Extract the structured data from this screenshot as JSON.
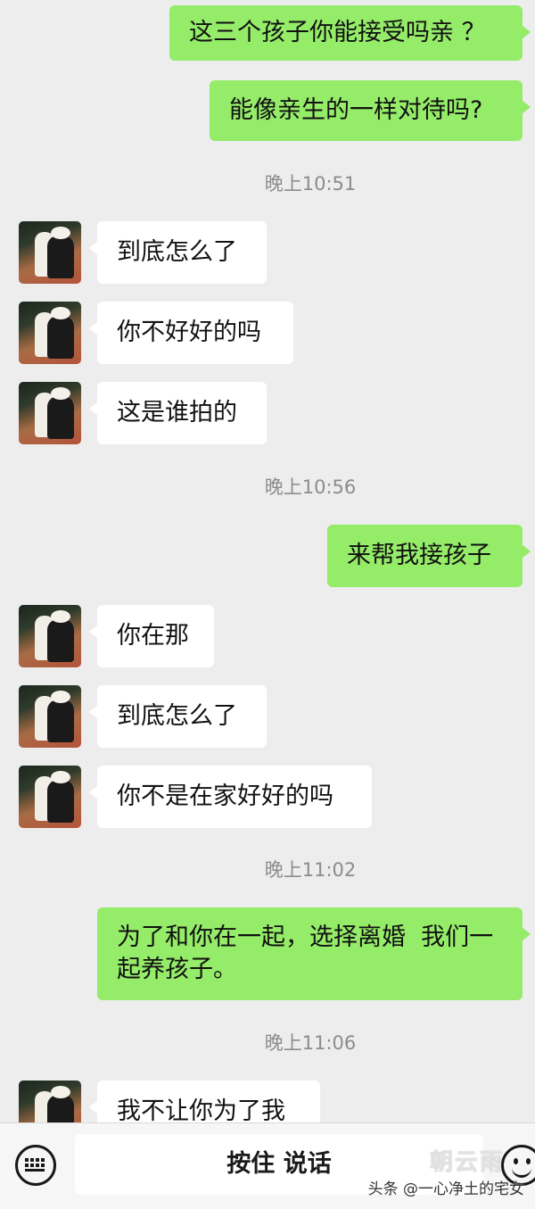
{
  "messages": [
    {
      "from": "me",
      "text": "这三个孩子你能接受吗亲 ？"
    },
    {
      "from": "me",
      "text": "能像亲生的一样对待吗?"
    },
    {
      "time": "晚上10:51"
    },
    {
      "from": "them",
      "text": "到底怎么了"
    },
    {
      "from": "them",
      "text": "你不好好的吗"
    },
    {
      "from": "them",
      "text": "这是谁拍的"
    },
    {
      "time": "晚上10:56"
    },
    {
      "from": "me",
      "text": "来帮我接孩子"
    },
    {
      "from": "them",
      "text": "你在那"
    },
    {
      "from": "them",
      "text": "到底怎么了"
    },
    {
      "from": "them",
      "text": "你不是在家好好的吗"
    },
    {
      "time": "晚上11:02"
    },
    {
      "from": "me",
      "text": "为了和你在一起，选择离婚  我们一起养孩子。"
    },
    {
      "time": "晚上11:06"
    },
    {
      "from": "them",
      "text": "我不让你为了我"
    }
  ],
  "input_bar": {
    "hold_to_talk_label": "按住 说话",
    "left_icon": "keyboard-icon",
    "right_icon": "emoji-icon"
  },
  "watermark": {
    "text": "头条 @一心净土的宅女",
    "logo_text": "朝云雨"
  },
  "colors": {
    "background": "#ededed",
    "sent_bubble": "#95ec69",
    "received_bubble": "#ffffff",
    "timestamp": "#8c8c8c"
  }
}
